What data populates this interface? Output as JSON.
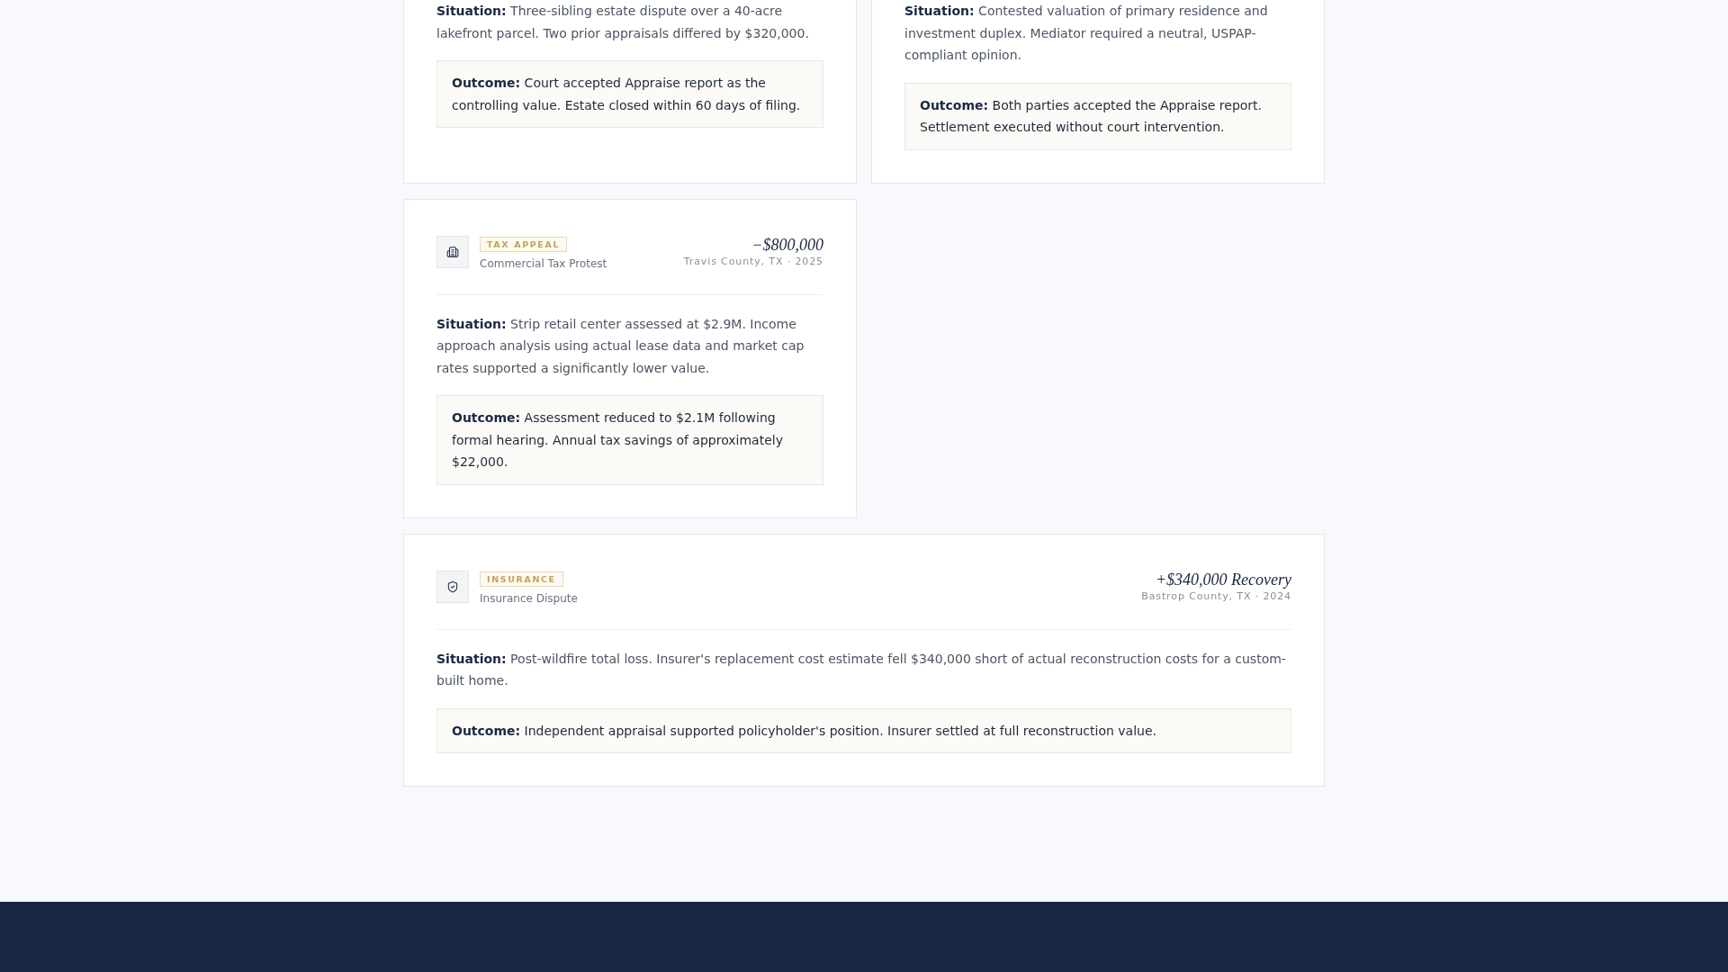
{
  "case_studies": [
    {
      "situation": "**Situation:** Three-sibling estate dispute over a 40-acre lakefront parcel. Two prior appraisals differed by $320,000.",
      "outcome": "**Outcome:** Court accepted Appraise report as the controlling value. Estate closed within 60 days of filing."
    },
    {
      "situation": "**Situation:** Contested valuation of primary residence and investment duplex. Mediator required a neutral, USPAP-compliant opinion.",
      "outcome": "**Outcome:** Both parties accepted the Appraise report. Settlement executed without court intervention."
    },
    {
      "kind": "tax_appeal",
      "tag": "TAX APPEAL",
      "title": "Commercial Tax Protest",
      "amount": "−$800,000",
      "location": "Travis County, TX · 2025",
      "situation": "**Situation:** Strip retail center assessed at $2.9M. Income approach analysis using actual lease data and market cap rates supported a significantly lower value.",
      "outcome": "**Outcome:** Assessment reduced to $2.1M following formal hearing. Annual tax savings of approximately $22,000."
    },
    {
      "kind": "insurance",
      "tag": "INSURANCE",
      "title": "Insurance Dispute",
      "amount": "+$340,000 Recovery",
      "location": "Bastrop County, TX · 2024",
      "situation": "**Situation:** Post-wildfire total loss. Insurer's replacement cost estimate fell $340,000 short of actual reconstruction costs for a custom-built home.",
      "outcome": "**Outcome:** Independent appraisal supported policyholder's position. Insurer settled at full reconstruction value."
    }
  ]
}
